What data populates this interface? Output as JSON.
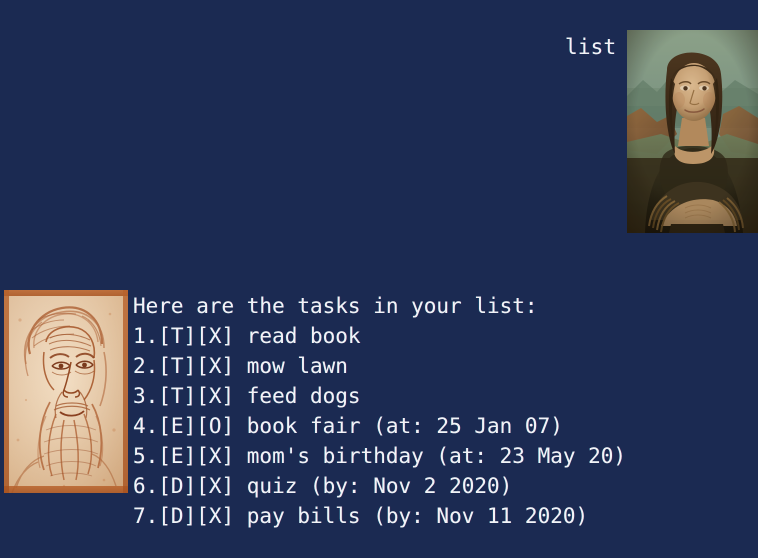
{
  "theme": {
    "background": "#1b2a52",
    "text": "#f2f3f7"
  },
  "header": {
    "label": "list"
  },
  "images": {
    "mona_lisa": {
      "name": "mona-lisa-image",
      "alt": "Mona Lisa painting"
    },
    "self_portrait": {
      "name": "self-portrait-image",
      "alt": "Leonardo da Vinci self portrait sanguine drawing"
    }
  },
  "console": {
    "heading": "Here are the tasks in your list:",
    "lines": [
      "Here are the tasks in your list:",
      "1.[T][X] read book",
      "2.[T][X] mow lawn",
      "3.[T][X] feed dogs",
      "4.[E][O] book fair (at: 25 Jan 07)",
      "5.[E][X] mom's birthday (at: 23 May 20)",
      "6.[D][X] quiz (by: Nov 2 2020)",
      "7.[D][X] pay bills (by: Nov 11 2020)"
    ],
    "tasks": [
      {
        "index": "1.",
        "type": "[T]",
        "status": "[X]",
        "description": "read book",
        "detail": ""
      },
      {
        "index": "2.",
        "type": "[T]",
        "status": "[X]",
        "description": "mow lawn",
        "detail": ""
      },
      {
        "index": "3.",
        "type": "[T]",
        "status": "[X]",
        "description": "feed dogs",
        "detail": ""
      },
      {
        "index": "4.",
        "type": "[E]",
        "status": "[O]",
        "description": "book fair",
        "detail": "(at: 25 Jan 07)"
      },
      {
        "index": "5.",
        "type": "[E]",
        "status": "[X]",
        "description": "mom's birthday",
        "detail": "(at: 23 May 20)"
      },
      {
        "index": "6.",
        "type": "[D]",
        "status": "[X]",
        "description": "quiz",
        "detail": "(by: Nov 2 2020)"
      },
      {
        "index": "7.",
        "type": "[D]",
        "status": "[X]",
        "description": "pay bills",
        "detail": "(by: Nov 11 2020)"
      }
    ]
  }
}
